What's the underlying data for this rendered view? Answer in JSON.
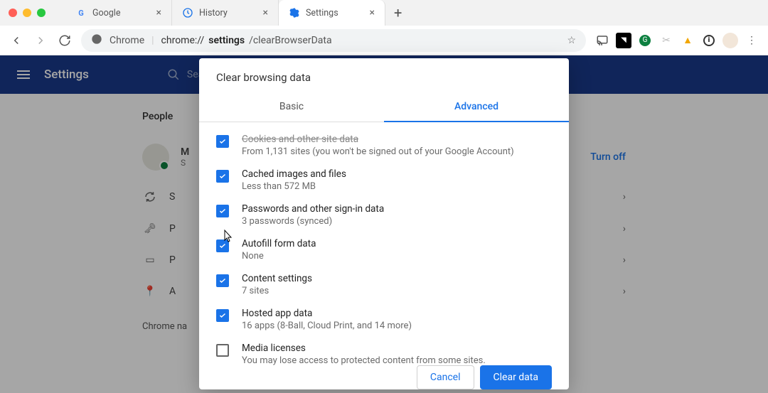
{
  "window": {
    "tabs": [
      {
        "label": "Google",
        "icon": "google"
      },
      {
        "label": "History",
        "icon": "history"
      },
      {
        "label": "Settings",
        "icon": "gear"
      }
    ],
    "active_tab": 2
  },
  "address_bar": {
    "site_label": "Chrome",
    "url_host": "chrome://",
    "url_path_bold": "settings",
    "url_path_rest": "/clearBrowserData"
  },
  "settings_page": {
    "app_title": "Settings",
    "search_placeholder": "Search",
    "section": "People",
    "rows": {
      "profile_initial": "M",
      "profile_sub": "S",
      "sync_label": "S",
      "p1": "P",
      "p2": "P",
      "a": "A",
      "turn_off": "Turn off"
    },
    "chrome_na": "Chrome na"
  },
  "dialog": {
    "title": "Clear browsing data",
    "tabs": {
      "basic": "Basic",
      "advanced": "Advanced"
    },
    "options": [
      {
        "key": "cookies",
        "checked": true,
        "label": "Cookies and other site data",
        "label_cut": true,
        "sub": "From 1,131 sites (you won't be signed out of your Google Account)"
      },
      {
        "key": "cache",
        "checked": true,
        "label": "Cached images and files",
        "sub": "Less than 572 MB"
      },
      {
        "key": "passwords",
        "checked": true,
        "label": "Passwords and other sign-in data",
        "sub": "3 passwords (synced)"
      },
      {
        "key": "autofill",
        "checked": true,
        "label": "Autofill form data",
        "sub": "None"
      },
      {
        "key": "content",
        "checked": true,
        "label": "Content settings",
        "sub": "7 sites"
      },
      {
        "key": "hosted",
        "checked": true,
        "label": "Hosted app data",
        "sub": "16 apps (8-Ball, Cloud Print, and 14 more)"
      },
      {
        "key": "media",
        "checked": false,
        "label": "Media licenses",
        "sub": "You may lose access to protected content from some sites."
      }
    ],
    "actions": {
      "cancel": "Cancel",
      "clear": "Clear data"
    }
  }
}
